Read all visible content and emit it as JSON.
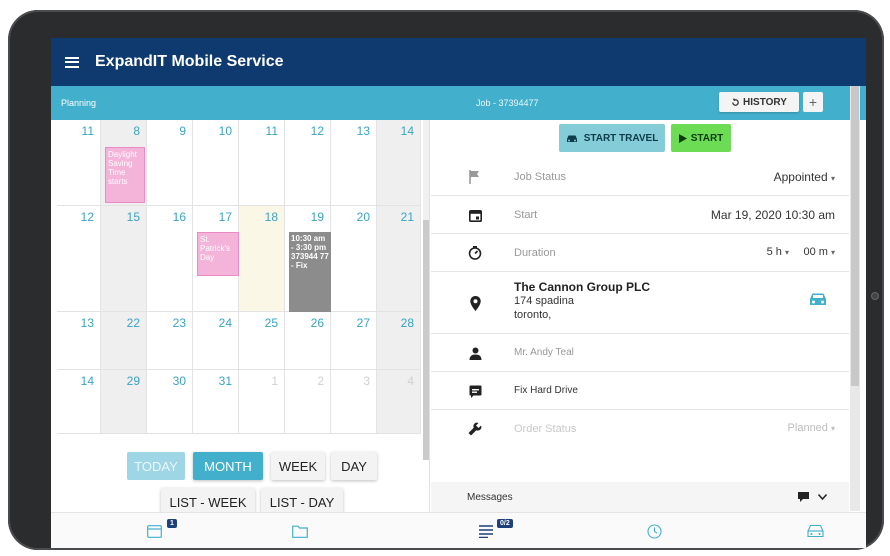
{
  "app": {
    "title": "ExpandIT Mobile Service"
  },
  "subbar": {
    "left_label": "Planning",
    "job_label": "Job - 37394477",
    "history_label": "HISTORY",
    "plus_label": "+"
  },
  "calendar": {
    "rows": [
      [
        "11",
        "8",
        "9",
        "10",
        "11",
        "12",
        "13",
        "14"
      ],
      [
        "12",
        "15",
        "16",
        "17",
        "18",
        "19",
        "20",
        "21"
      ],
      [
        "13",
        "22",
        "23",
        "24",
        "25",
        "26",
        "27",
        "28"
      ],
      [
        "14",
        "29",
        "30",
        "31",
        "1",
        "2",
        "3",
        "4"
      ]
    ],
    "events": {
      "daylight": "Daylight Saving Time starts",
      "patricks": "St. Patrick's Day",
      "job": "10:30 am - 3:30 pm 373944 77 - Fix"
    },
    "view_buttons": {
      "today": "TODAY",
      "month": "MONTH",
      "week": "WEEK",
      "day": "DAY",
      "list_week": "LIST - WEEK",
      "list_day": "LIST - DAY"
    }
  },
  "actions": {
    "start_travel": "START TRAVEL",
    "start": "START"
  },
  "details": {
    "job_status": {
      "label": "Job Status",
      "value": "Appointed"
    },
    "start": {
      "label": "Start",
      "value": "Mar 19, 2020 10:30 am"
    },
    "duration": {
      "label": "Duration",
      "hours": "5 h",
      "minutes": "00 m"
    },
    "customer": {
      "name": "The Cannon Group PLC",
      "street": "174 spadina",
      "city": "toronto,"
    },
    "contact": "Mr. Andy Teal",
    "task": "Fix Hard Drive",
    "order_status": {
      "label": "Order Status",
      "value": "Planned"
    },
    "messages_label": "Messages"
  },
  "bottomnav": {
    "calendar_badge": "1",
    "list_badge": "0/2"
  },
  "colors": {
    "header": "#0f3a70",
    "accent": "#42b0cc",
    "start": "#6ddc55",
    "event_pink": "#f4b3d8",
    "event_gray": "#8c8c8c"
  }
}
